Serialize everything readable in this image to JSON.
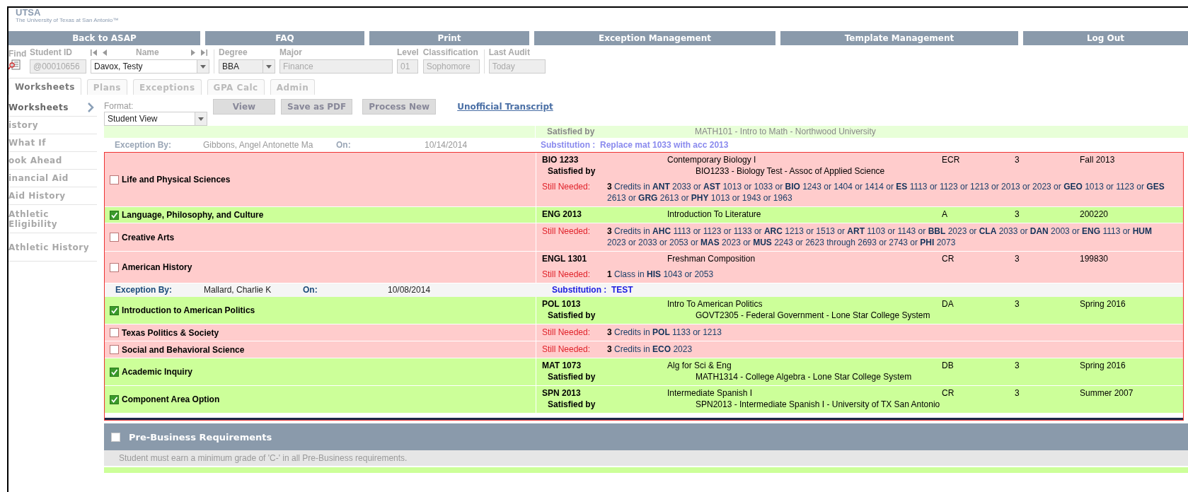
{
  "logo": {
    "mark": "UTSA",
    "subtitle": "The University of Texas at San Antonio™"
  },
  "nav": [
    "Back to ASAP",
    "FAQ",
    "Print",
    "Exception Management",
    "Template Management",
    "Log Out"
  ],
  "student": {
    "find_label": "Find",
    "id_label": "Student ID",
    "id": "@00010656",
    "name_label": "Name",
    "name": "Davox, Testy",
    "degree_label": "Degree",
    "degree": "BBA",
    "major_label": "Major",
    "major": "Finance",
    "level_label": "Level",
    "level": "01",
    "classification_label": "Classification",
    "classification": "Sophomore",
    "audit_label": "Last Audit",
    "audit": "Today"
  },
  "tabs": [
    {
      "label": "Worksheets",
      "selected": true
    },
    {
      "label": "Plans",
      "selected": false
    },
    {
      "label": "Exceptions",
      "selected": false
    },
    {
      "label": "GPA Calc",
      "selected": false
    },
    {
      "label": "Admin",
      "selected": false
    }
  ],
  "sidebar": {
    "items": [
      {
        "label": "Worksheets",
        "selected": true
      },
      {
        "label": "istory",
        "selected": false
      },
      {
        "label": "What If",
        "selected": false
      },
      {
        "label": "ook Ahead",
        "selected": false
      },
      {
        "label": "inancial Aid",
        "selected": false
      },
      {
        "label": "Aid History",
        "selected": false
      },
      {
        "label": "Athletic Eligibility",
        "selected": false
      },
      {
        "label": "Athletic History",
        "selected": false
      }
    ]
  },
  "toolbar": {
    "format_label": "Format:",
    "format": "Student View",
    "buttons": [
      "View",
      "Save as PDF",
      "Process New"
    ],
    "link": "Unofficial Transcript"
  },
  "leading_rows": [
    {
      "kind": "continued",
      "satisfied_label": "Satisfied by",
      "satisfied_text": "MATH101 - Intro to Math - Northwood University"
    },
    {
      "kind": "exception",
      "faded": true,
      "by_label": "Exception By:",
      "by": "Gibbons, Angel Antonette Ma",
      "on_label": "On:",
      "date": "10/14/2014",
      "substitution": "Substitution :  Replace mat 1033 with acc 2013"
    }
  ],
  "requirement_block": {
    "rows": [
      {
        "kind": "requirement",
        "title": "Life and Physical Sciences",
        "checked": false,
        "courses": [
          {
            "code": "BIO 1233",
            "title": "Contemporary Biology I",
            "grade": "ECR",
            "credits": "3",
            "term": "Fall 2013",
            "satisfied_label": "Satisfied by",
            "satisfied_text": "BIO1233 - Biology Test - Assoc of Applied Science"
          }
        ],
        "still_needed": {
          "label": "Still Needed:",
          "text": "**3** Credits in **ANT** 2033 or **AST** 1013 or 1033 or **BIO** 1243 or 1404 or 1414 or **ES** 1113 or 1123 or 1213 or 2013 or 2023 or **GEO** 1013 or 1123 or **GES** 2613 or **GRG** 2613 or **PHY** 1013 or 1943 or 1963"
        }
      },
      {
        "kind": "requirement",
        "title": "Language, Philosophy, and Culture",
        "checked": true,
        "courses": [
          {
            "code": "ENG 2013",
            "title": "Introduction To Literature",
            "grade": "A",
            "credits": "3",
            "term": "200220"
          }
        ]
      },
      {
        "kind": "requirement",
        "title": "Creative Arts",
        "checked": false,
        "courses": [],
        "still_needed": {
          "label": "Still Needed:",
          "text": "**3** Credits in **AHC** 1113 or 1123 or 1133 or **ARC** 1213 or 1513 or **ART** 1103 or 1143 or **BBL** 2023 or **CLA** 2033 or **DAN** 2003 or **ENG** 1113 or **HUM** 2023 or 2033 or 2053 or **MAS** 2023 or **MUS** 2243 or 2623 through 2693 or 2743 or **PHI** 2073"
        }
      },
      {
        "kind": "requirement",
        "title": "American History",
        "checked": false,
        "courses": [
          {
            "code": "ENGL 1301",
            "title": "Freshman Composition",
            "grade": "CR",
            "credits": "3",
            "term": "199830"
          }
        ],
        "still_needed": {
          "label": "Still Needed:",
          "text": "**1** Class in **HIS** 1043 or 2053"
        }
      },
      {
        "kind": "exception",
        "faded": false,
        "by_label": "Exception By:",
        "by": "Mallard, Charlie K",
        "on_label": "On:",
        "date": "10/08/2014",
        "substitution": "Substitution :  TEST"
      },
      {
        "kind": "requirement",
        "title": "Introduction to American Politics",
        "checked": true,
        "courses": [
          {
            "code": "POL 1013",
            "title": "Intro To American Politics",
            "grade": "DA",
            "credits": "3",
            "term": "Spring 2016",
            "satisfied_label": "Satisfied by",
            "satisfied_text": "GOVT2305 - Federal Government - Lone Star College System"
          }
        ]
      },
      {
        "kind": "requirement",
        "title": "Texas Politics & Society",
        "checked": false,
        "courses": [],
        "still_needed": {
          "label": "Still Needed:",
          "text": "**3** Credits in **POL** 1133 or 1213"
        }
      },
      {
        "kind": "requirement",
        "title": "Social and Behavioral Science",
        "checked": false,
        "courses": [],
        "still_needed": {
          "label": "Still Needed:",
          "text": "**3** Credits in **ECO** 2023"
        }
      },
      {
        "kind": "requirement",
        "title": "Academic Inquiry",
        "checked": true,
        "courses": [
          {
            "code": "MAT 1073",
            "title": "Alg for Sci & Eng",
            "grade": "DB",
            "credits": "3",
            "term": "Spring 2016",
            "satisfied_label": "Satisfied by",
            "satisfied_text": "MATH1314 - College Algebra - Lone Star College System"
          }
        ]
      },
      {
        "kind": "requirement",
        "title": "Component Area Option",
        "checked": true,
        "courses": [
          {
            "code": "SPN 2013",
            "title": "Intermediate Spanish I",
            "grade": "CR",
            "credits": "3",
            "term": "Summer 2007",
            "satisfied_label": "Satisfied by",
            "satisfied_text": "SPN2013 - Intermediate Spanish I - University of TX San Antonio"
          }
        ]
      }
    ]
  },
  "section": {
    "title": "Pre-Business Requirements",
    "checked": false,
    "note": "Student must earn a minimum grade of 'C-' in all Pre-Business requirements."
  }
}
